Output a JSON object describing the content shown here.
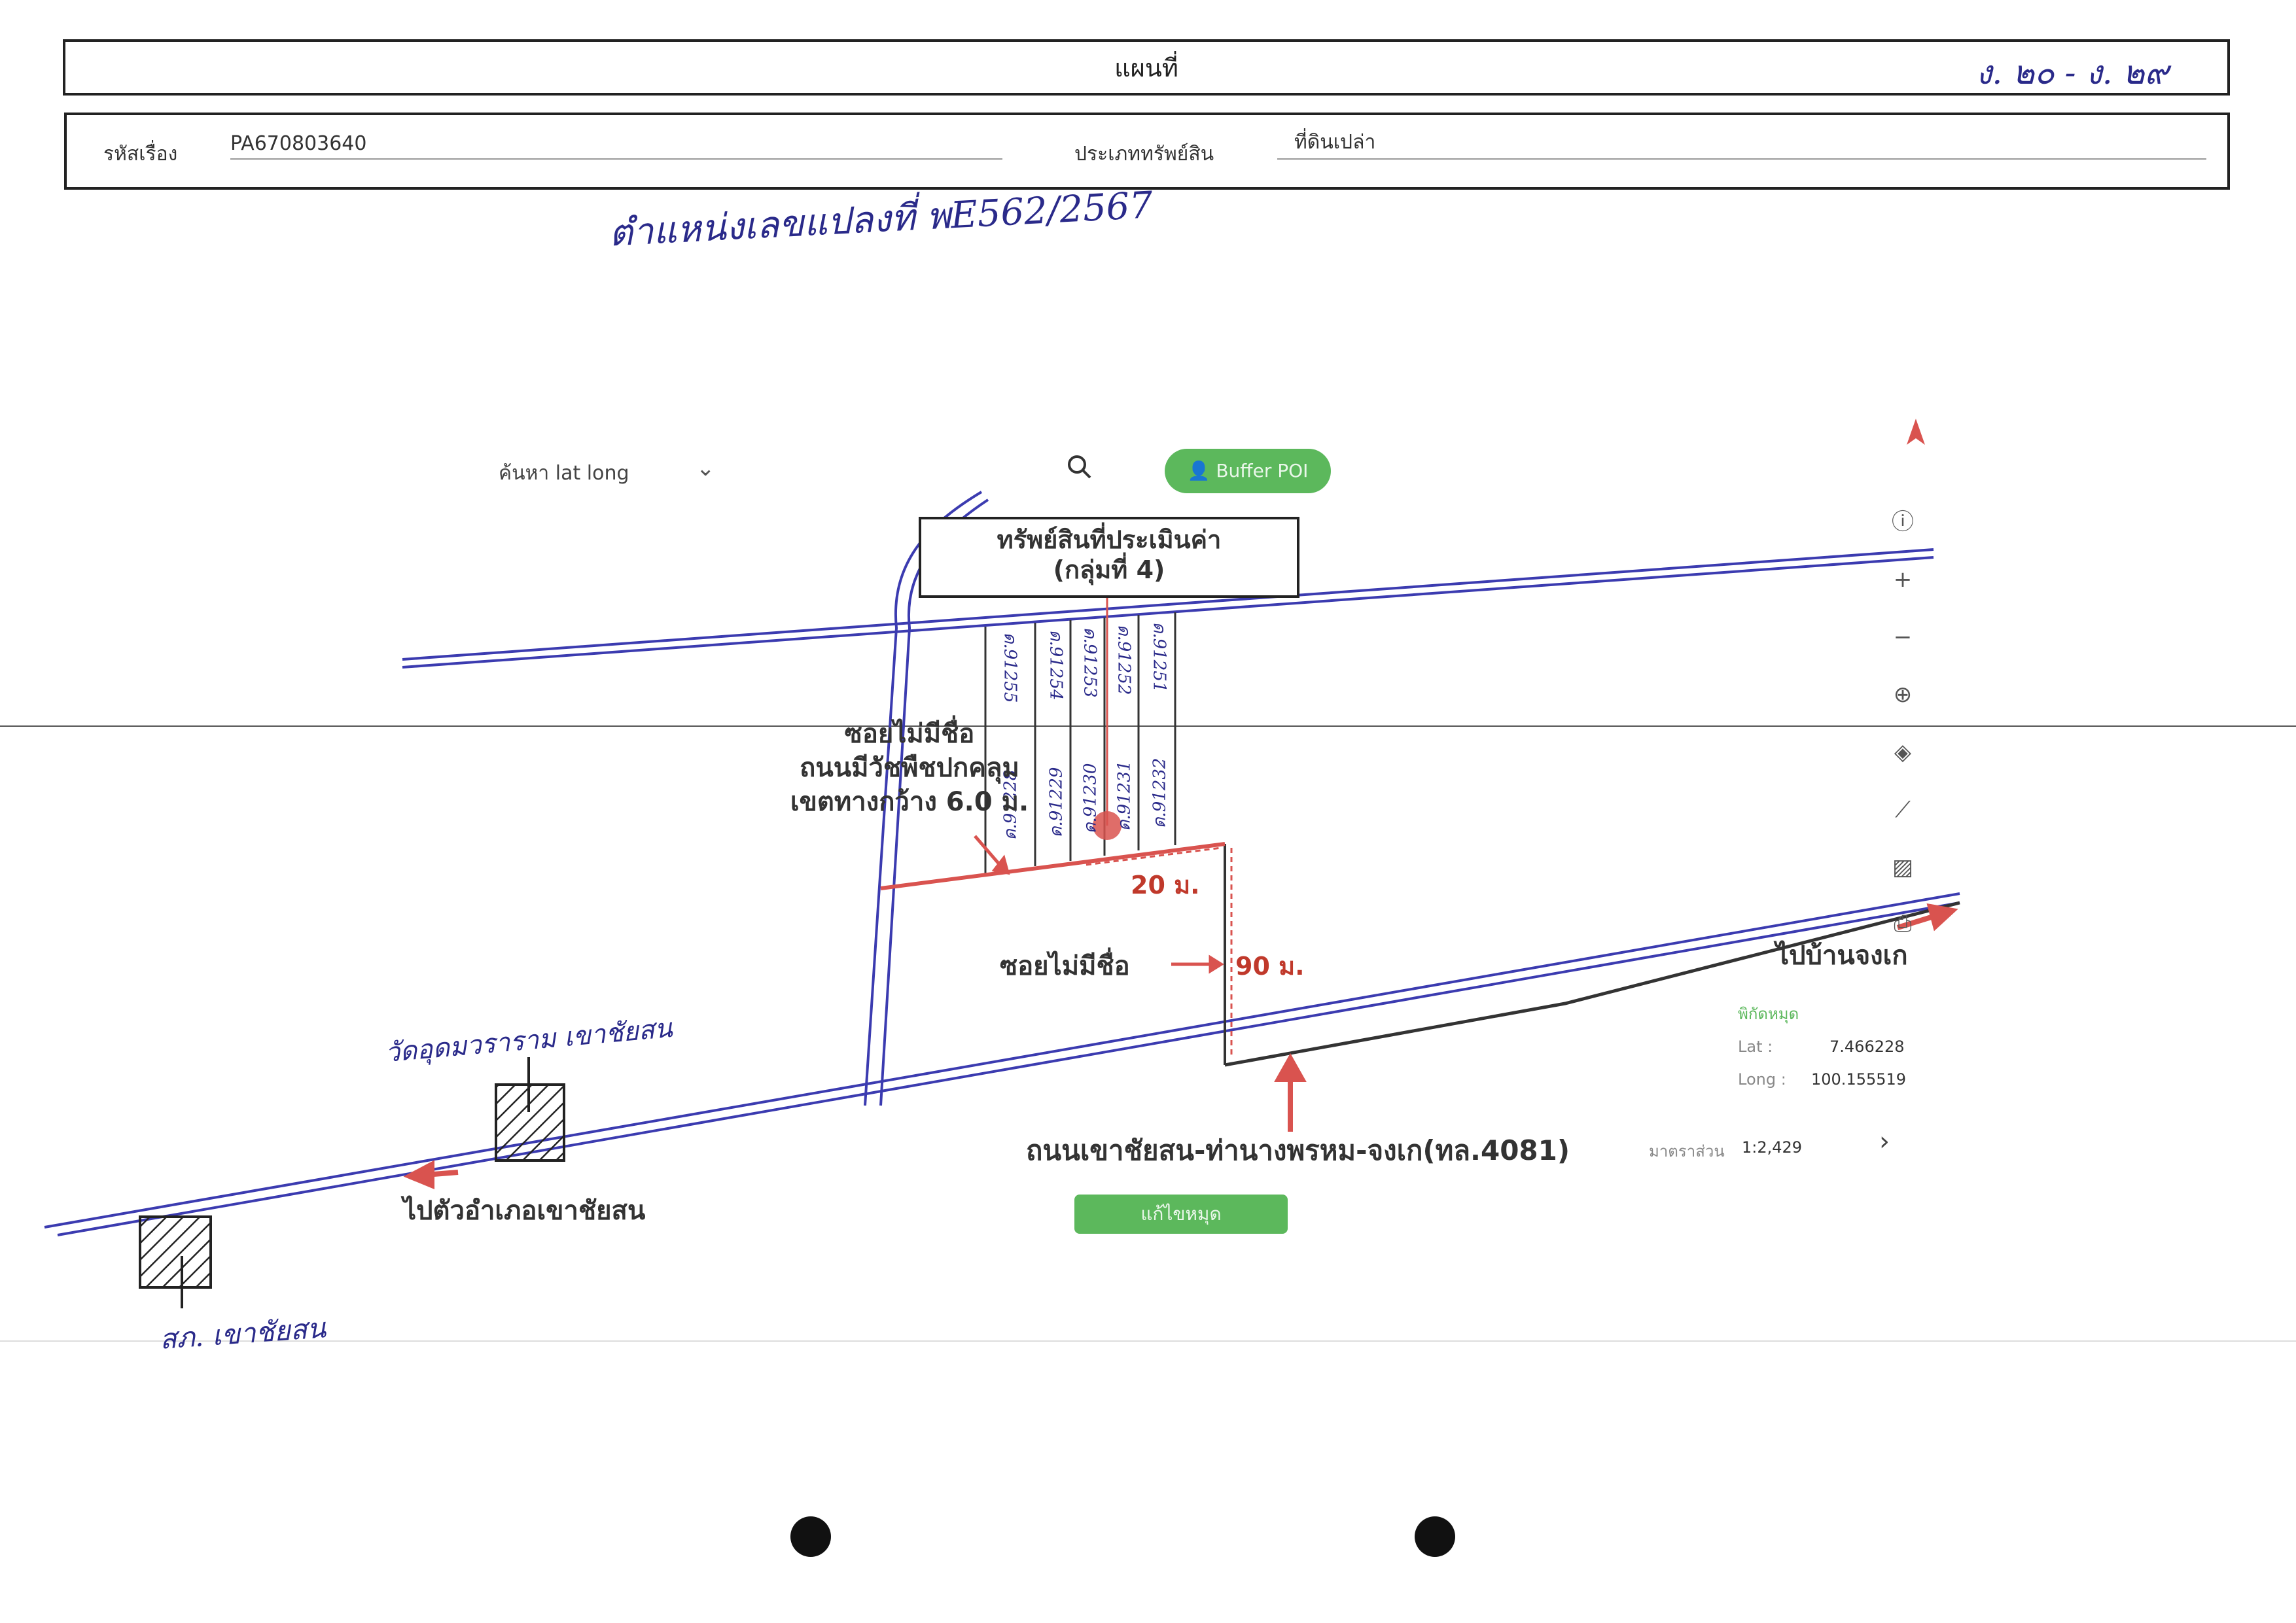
{
  "header": {
    "title": "แผนที่",
    "page_ref_handwritten": "ง. ๒๐ - ง. ๒๙"
  },
  "fields": {
    "case_label": "รหัสเรื่อง",
    "case_value": "PA670803640",
    "type_label": "ประเภททรัพย์สิน",
    "type_value": "ที่ดินเปล่า"
  },
  "handwritten_note": "ตำแหน่งเลขแปลงที่ พE562/2567",
  "map_ui": {
    "search_label": "ค้นหา lat long",
    "search_placeholder": "",
    "buffer_button": "Buffer POI",
    "edit_button": "แก้ไขหมุด",
    "coords": {
      "title": "พิกัดหมุด",
      "lat_label": "Lat :",
      "lat_value": "7.466228",
      "long_label": "Long :",
      "long_value": "100.155519"
    },
    "scale_label": "มาตราส่วน",
    "scale_value": "1:2,429"
  },
  "annotations": {
    "asset_line1": "ทรัพย์สินที่ประเมินค่า",
    "asset_line2": "(กลุ่มที่ 4)",
    "soi_line1": "ซอยไม่มีชื่อ",
    "soi_line2": "ถนนมีวัชพืชปกคลุม",
    "soi_line3": "เขตทางกว้าง 6.0 ม.",
    "soi_arrow": "ซอยไม่มีชื่อ",
    "dim_20": "20 ม.",
    "dim_90": "90 ม.",
    "to_jongke": "ไปบ้านจงเก",
    "main_road": "ถนนเขาชัยสน-ท่านางพรหม-จงเก(ทล.4081)",
    "to_district": "ไปตัวอำเภอเขาชัยสน",
    "temple_hand": "วัดอุดมวราราม เขาชัยสน",
    "station_hand": "สภ. เขาชัยสน"
  },
  "plots": {
    "top_row": [
      "ด.91255",
      "ด.91254",
      "ด.91253",
      "ด.91252",
      "ด.91251"
    ],
    "bottom_row": [
      "ด.91228",
      "ด.91229",
      "ด.91230",
      "ด.91231",
      "ด.91232"
    ]
  },
  "colors": {
    "road_line": "#3b3bb0",
    "accent_red": "#d9534f",
    "dim_red": "#c0392b",
    "ui_green": "#5cb85c",
    "hand_ink": "#2a2a8a"
  }
}
